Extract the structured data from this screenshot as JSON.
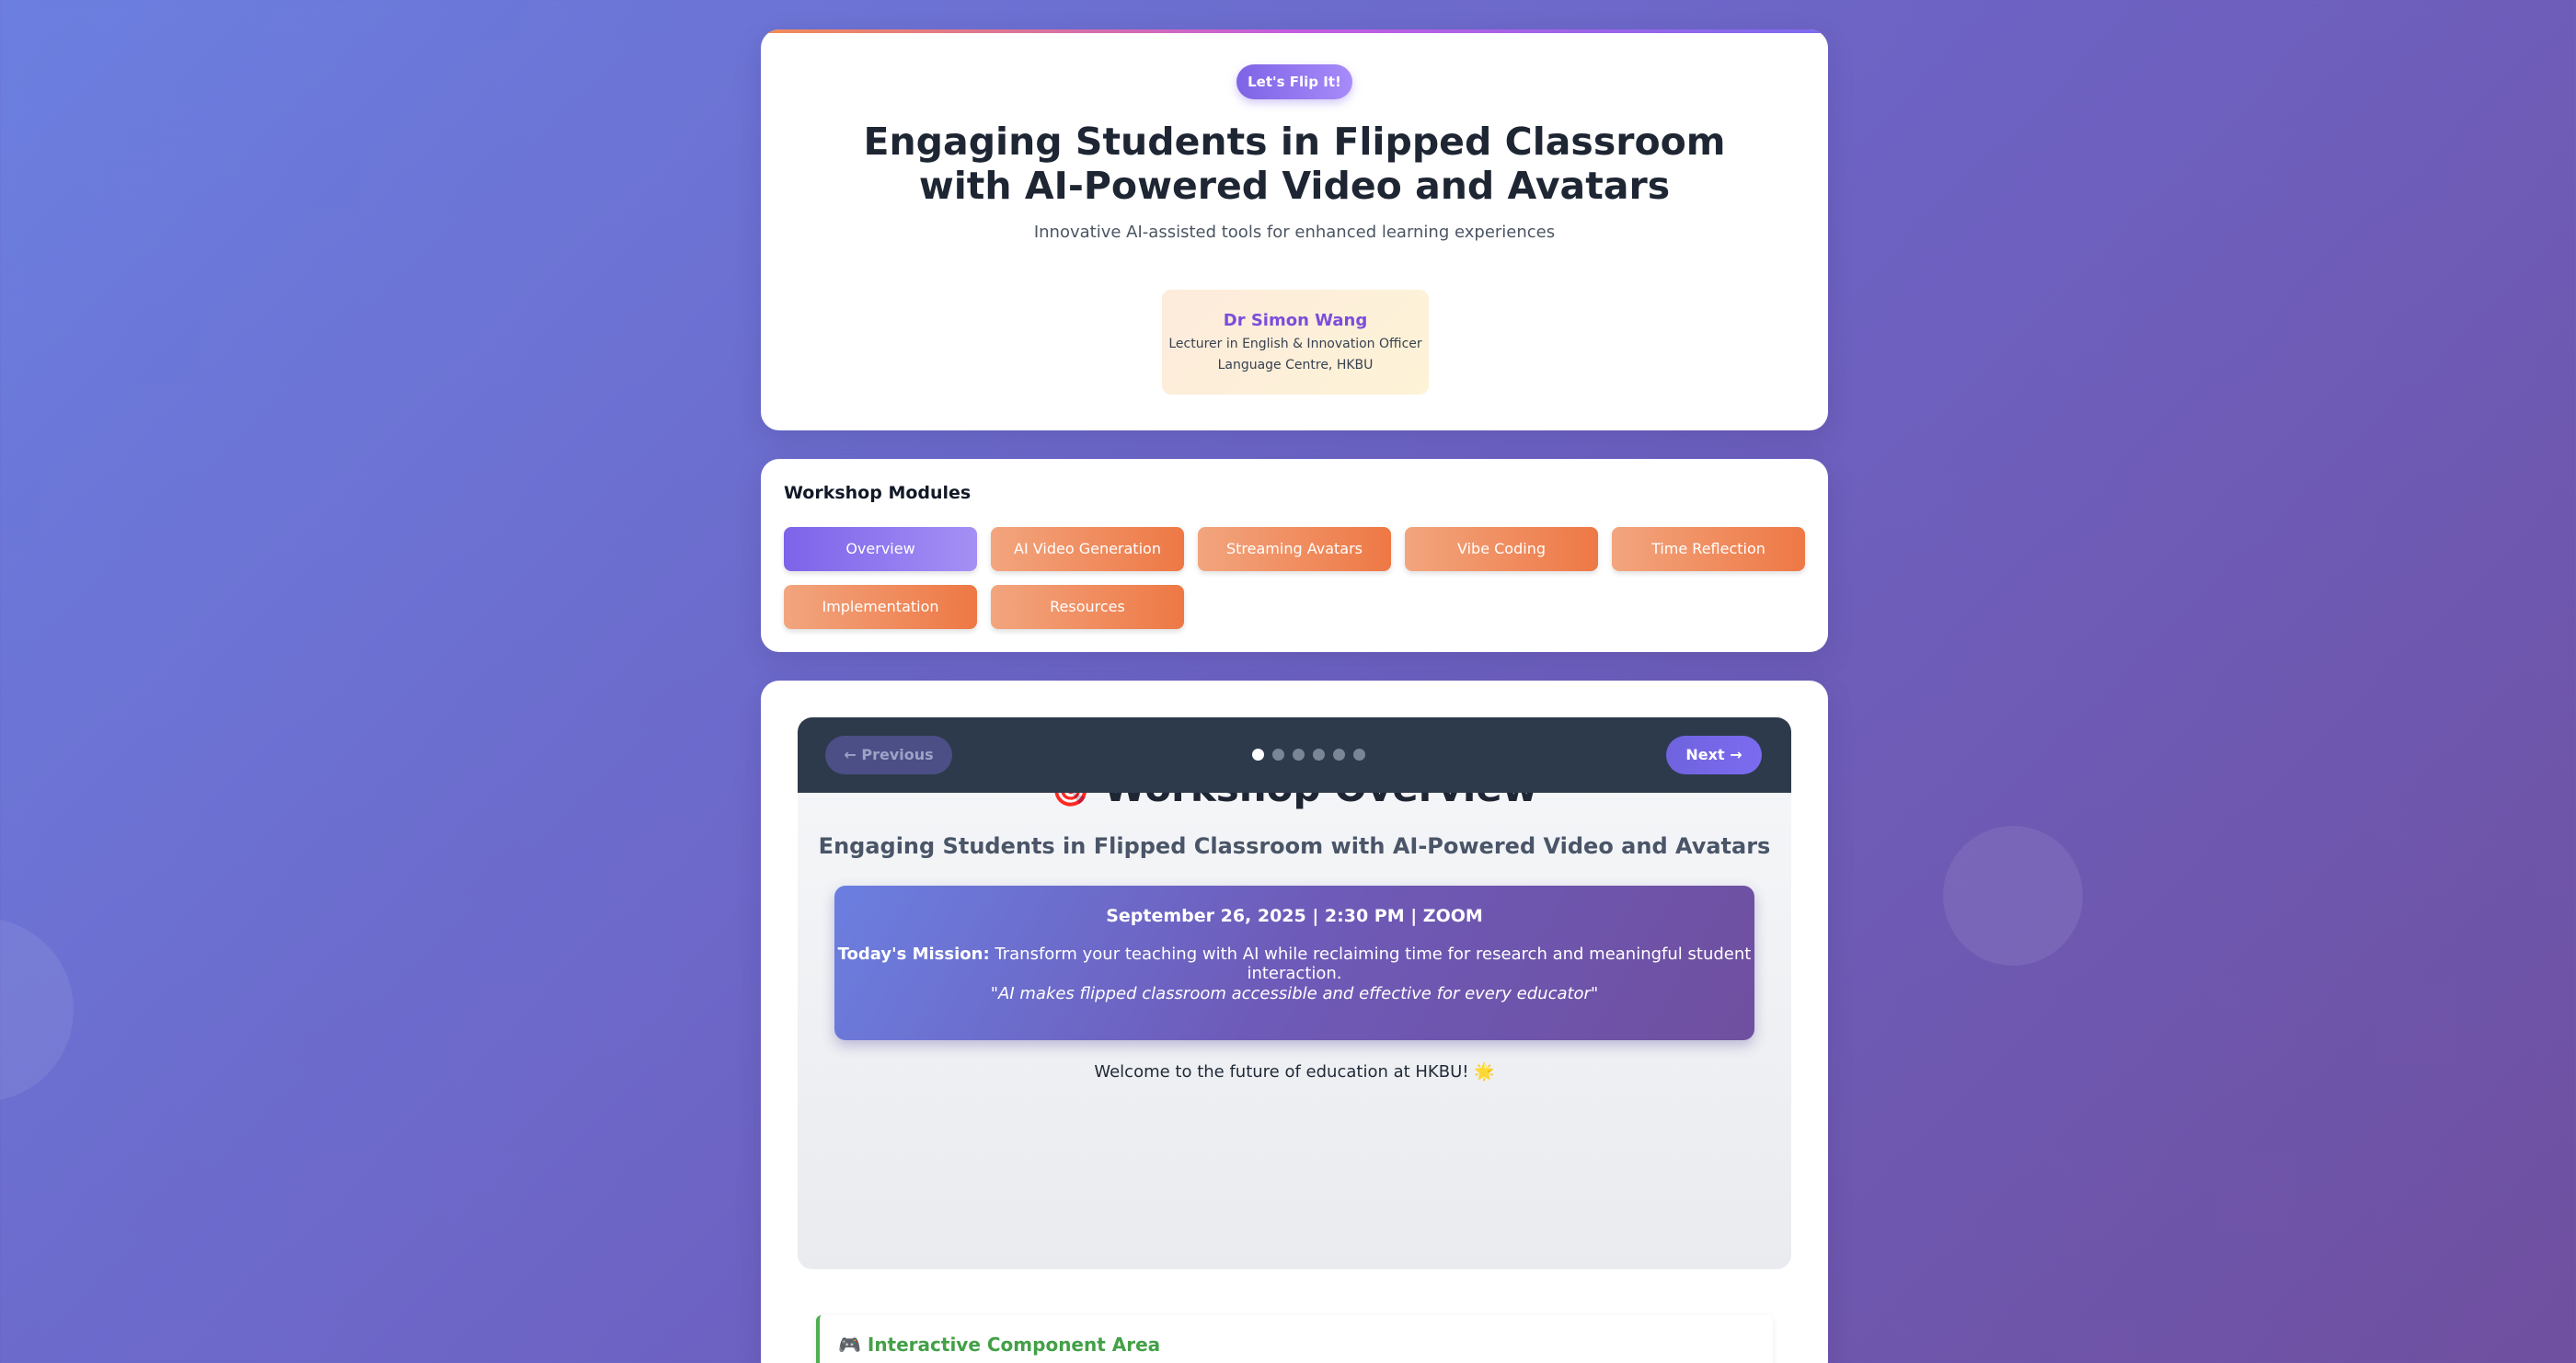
{
  "header": {
    "badge": "Let's Flip It!",
    "title": "Engaging Students in Flipped Classroom with AI-Powered Video and Avatars",
    "subtitle": "Innovative AI-assisted tools for enhanced learning experiences",
    "presenter": {
      "name": "Dr Simon Wang",
      "role": "Lecturer in English & Innovation Officer",
      "affiliation": "Language Centre, HKBU"
    }
  },
  "modules": {
    "title": "Workshop Modules",
    "active": "Overview",
    "items": [
      {
        "label": "Overview"
      },
      {
        "label": "AI Video Generation"
      },
      {
        "label": "Streaming Avatars"
      },
      {
        "label": "Vibe Coding"
      },
      {
        "label": "Time Reflection"
      },
      {
        "label": "Implementation"
      },
      {
        "label": "Resources"
      }
    ]
  },
  "slide": {
    "nav": {
      "prev_label": "← Previous",
      "next_label": "Next →",
      "dot_count": 6,
      "active_dot": 1
    },
    "heading_emoji": "🎯",
    "heading": "Workshop Overview",
    "subheading": "Engaging Students in Flipped Classroom with AI-Powered Video and Avatars",
    "mission": {
      "date_line": "September 26, 2025 | 2:30 PM | ZOOM",
      "mission_label": "Today's Mission:",
      "mission_text": " Transform your teaching with AI while reclaiming time for research and meaningful student interaction.",
      "quote": "\"AI makes flipped classroom accessible and effective for every educator\""
    },
    "welcome": "Welcome to the future of education at HKBU! 🌟"
  },
  "interactive": {
    "emoji": "🎮",
    "title": "Interactive Component Area"
  }
}
